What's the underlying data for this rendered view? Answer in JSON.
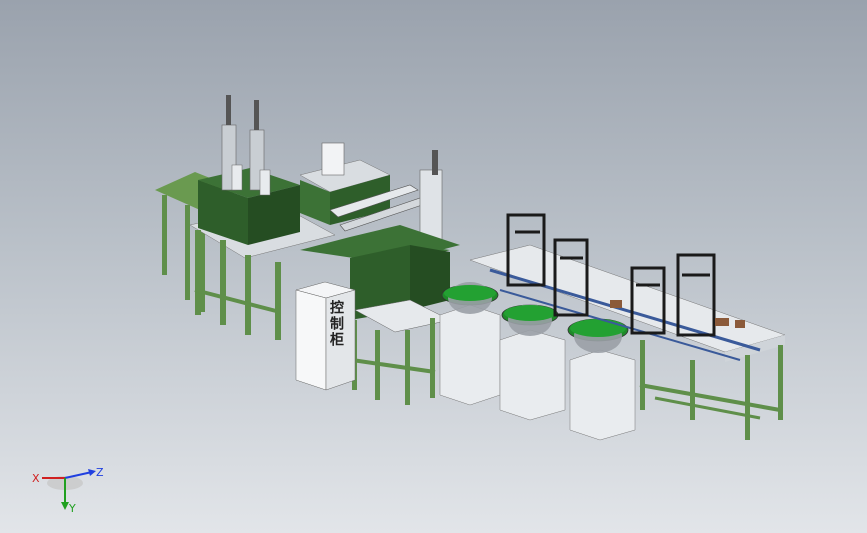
{
  "triad": {
    "x_label": "X",
    "y_label": "Y",
    "z_label": "Z",
    "colors": {
      "x": "#d02020",
      "y": "#20a020",
      "z": "#2040e0"
    }
  },
  "cabinet": {
    "text": "控制柜"
  },
  "palette": {
    "frame_green": "#5f8f4a",
    "panel_green": "#2e5e2a",
    "bowl_green": "#1f8a2a",
    "white_box": "#eceff1",
    "rail_blue": "#3a5a9a",
    "steel": "#8a8f95"
  }
}
